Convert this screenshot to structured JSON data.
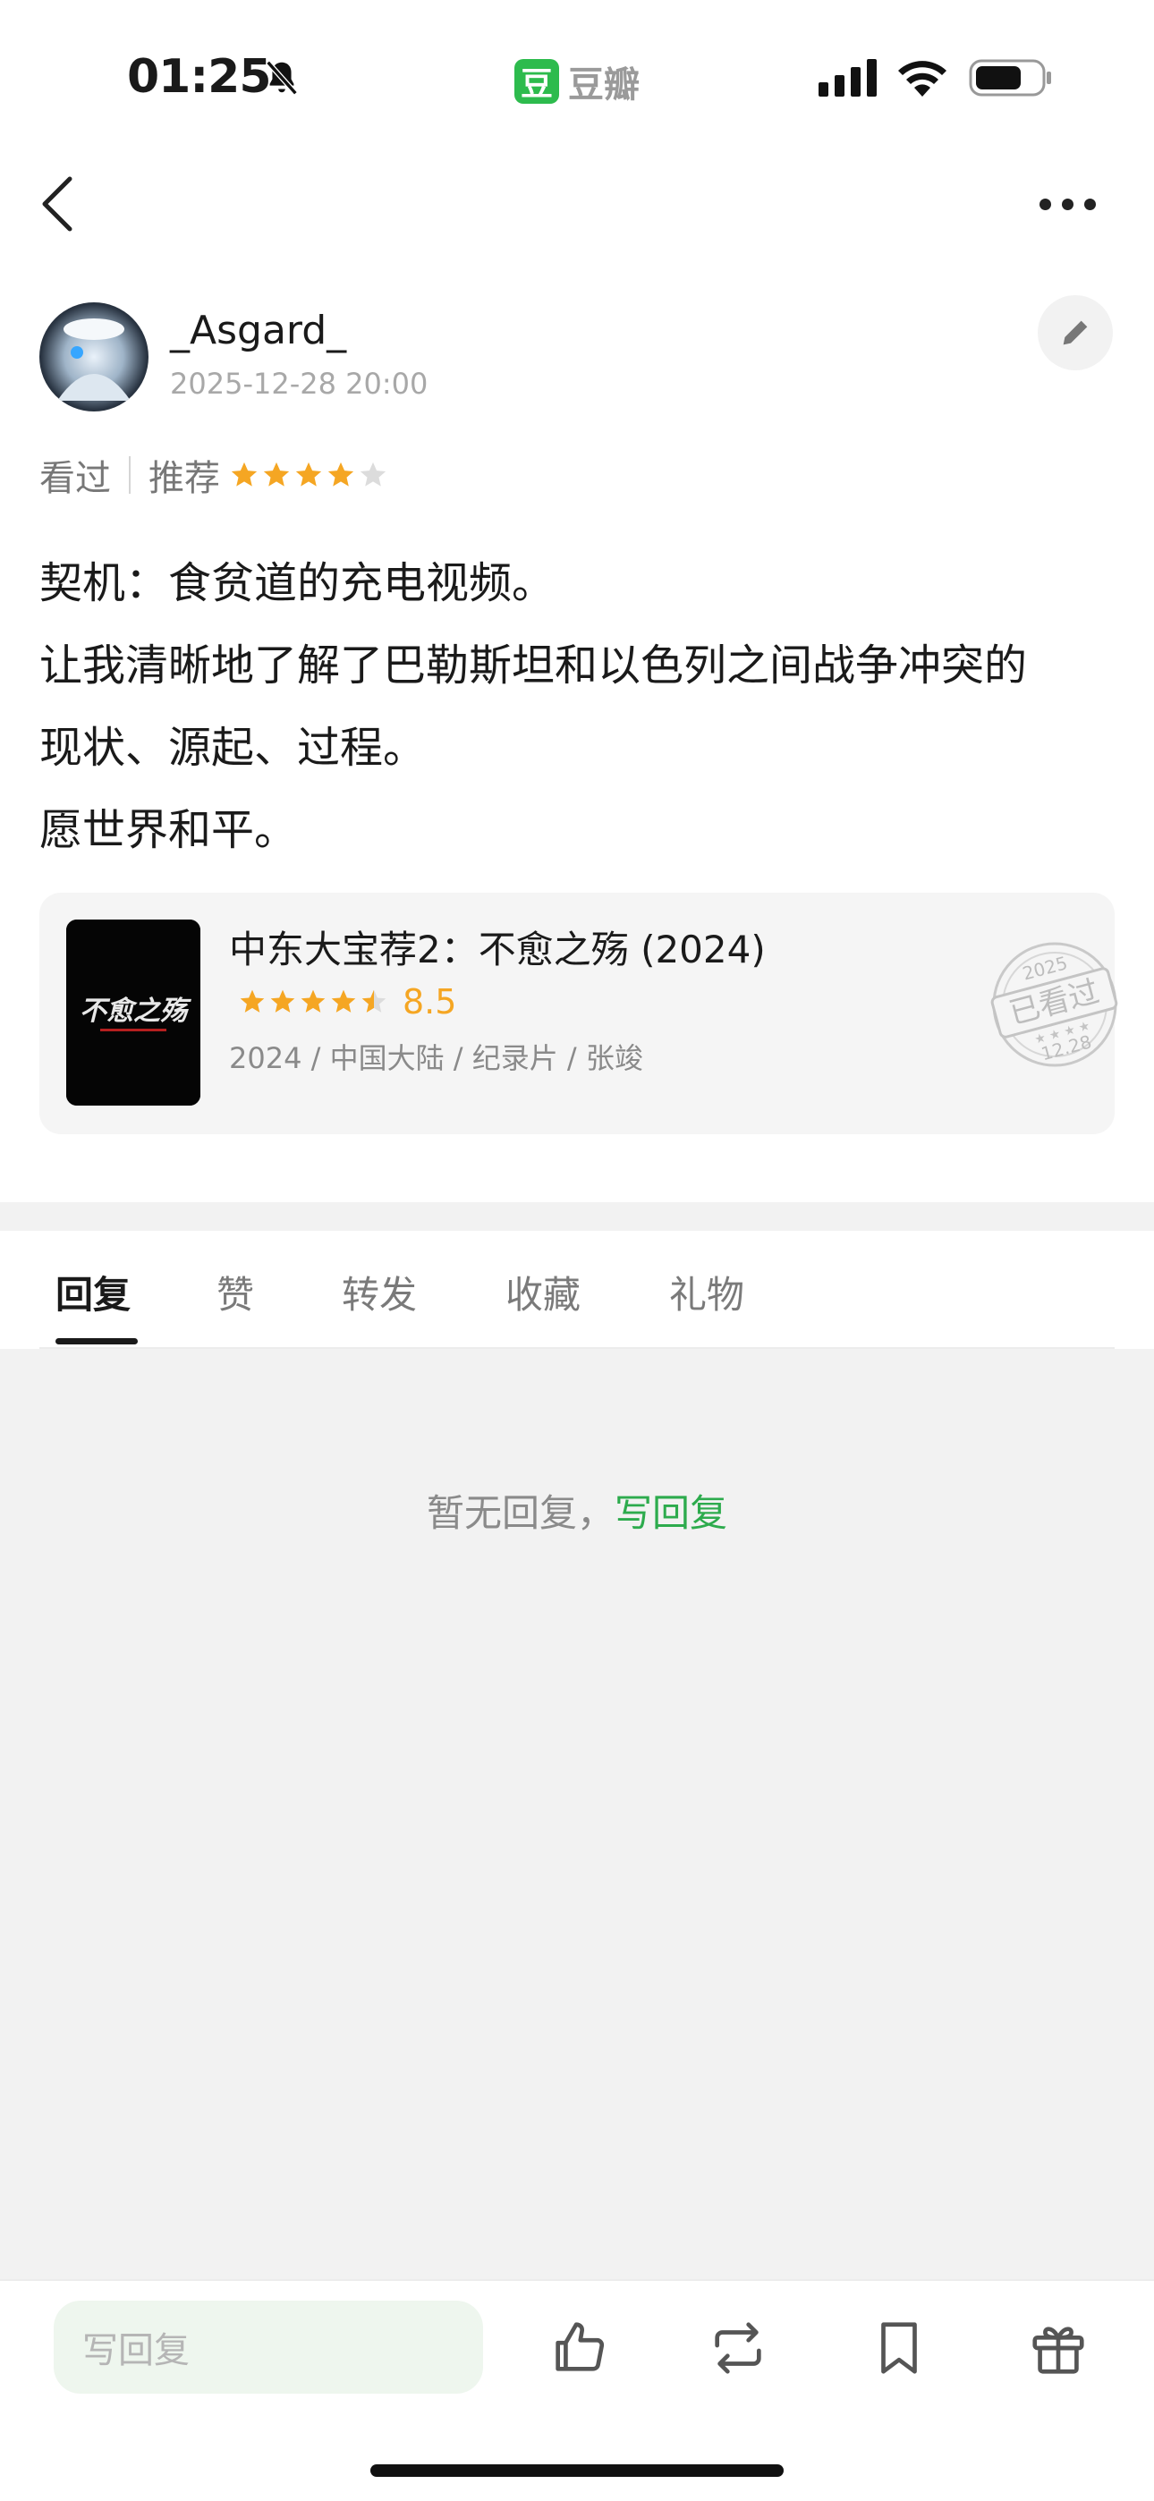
{
  "status_bar": {
    "time": "01:25",
    "app_logo_char": "豆",
    "app_name": "豆瓣",
    "icons": [
      "bell-muted-icon",
      "signal-icon",
      "wifi-icon",
      "battery-icon"
    ]
  },
  "nav": {
    "back_icon": "chevron-left-icon",
    "more_icon": "ellipsis-icon"
  },
  "author": {
    "username": "_Asgard_",
    "date": "2025-12-28 20:00",
    "edit_icon": "pencil-icon"
  },
  "review_meta": {
    "status": "看过",
    "recommend_label": "推荐",
    "user_rating": 4,
    "max_rating": 5
  },
  "review": {
    "lines": [
      "契机：食贫道的充电视频。",
      "让我清晰地了解了巴勒斯坦和以色列之间战争冲突的",
      "现状、源起、过程。",
      "愿世界和平。"
    ]
  },
  "movie": {
    "title": "中东大宝荐2：不愈之殇 (2024)",
    "rating": "8.5",
    "star_value": 4.5,
    "meta": "2024 / 中国大陆 / 纪录片 / 张竣",
    "poster_text": "不愈之殇",
    "stamp": {
      "year": "2025",
      "label": "已看过",
      "date": "12.28"
    }
  },
  "tabs": [
    {
      "label": "回复",
      "active": true
    },
    {
      "label": "赞",
      "active": false
    },
    {
      "label": "转发",
      "active": false
    },
    {
      "label": "收藏",
      "active": false
    },
    {
      "label": "礼物",
      "active": false
    }
  ],
  "empty_state": {
    "text": "暂无回复，",
    "link": "写回复"
  },
  "bottom_bar": {
    "input_placeholder": "写回复",
    "icons": [
      "thumbs-up-icon",
      "repost-icon",
      "bookmark-icon",
      "gift-icon"
    ]
  },
  "colors": {
    "accent_green": "#2dab4d",
    "star_orange": "#f5a623"
  }
}
